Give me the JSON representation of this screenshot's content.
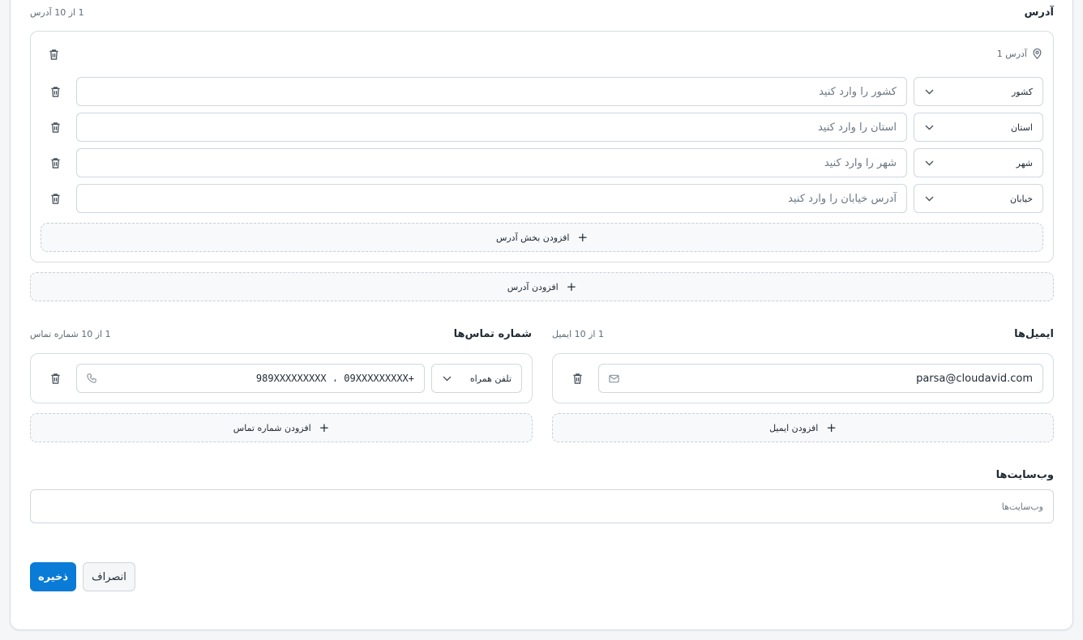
{
  "address": {
    "title": "آدرس",
    "count": "1 از 10 آدرس",
    "item_label": "آدرس 1",
    "rows": [
      {
        "type": "کشور",
        "placeholder": "کشور را وارد کنید"
      },
      {
        "type": "استان",
        "placeholder": "استان را وارد کنید"
      },
      {
        "type": "شهر",
        "placeholder": "شهر را وارد کنید"
      },
      {
        "type": "خیابان",
        "placeholder": "آدرس خیابان را وارد کنید"
      }
    ],
    "add_part_label": "افزودن بخش آدرس",
    "add_address_label": "افزودن آدرس"
  },
  "emails": {
    "title": "ایمیل‌ها",
    "count": "1 از 10 ایمیل",
    "value": "parsa@cloudavid.com",
    "add_label": "افزودن ایمیل"
  },
  "phones": {
    "title": "شماره تماس‌ها",
    "count": "1 از 10 شماره تماس",
    "type": "تلفن همراه",
    "value": "+989XXXXXXXXX ، 09XXXXXXXXX",
    "add_label": "افزودن شماره تماس"
  },
  "websites": {
    "title": "وب‌سایت‌ها",
    "placeholder": "وب‌سایت‌ها"
  },
  "actions": {
    "save_label": "ذخیره",
    "cancel_label": "انصراف"
  },
  "colors": {
    "primary": "#0a7bd6",
    "border": "#d6dde3",
    "text": "#1f2933",
    "muted": "#5f6b76"
  },
  "icons": [
    "trash-icon",
    "location-pin-icon",
    "chevron-down-icon",
    "plus-icon",
    "mail-icon",
    "phone-icon"
  ]
}
